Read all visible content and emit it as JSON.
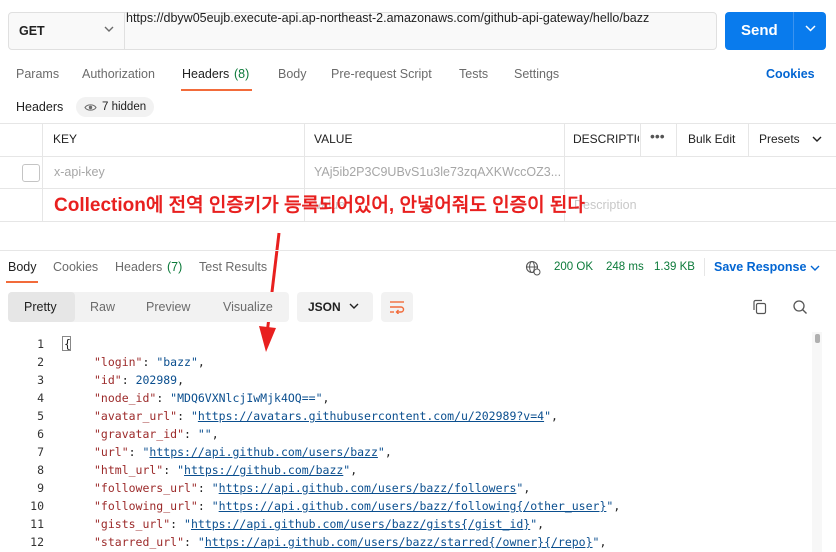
{
  "request": {
    "method": "GET",
    "url": "https://dbyw05eujb.execute-api.ap-northeast-2.amazonaws.com/github-api-gateway/hello/bazz",
    "send_label": "Send"
  },
  "request_tabs": [
    "Params",
    "Authorization",
    "Headers",
    "(8)",
    "Body",
    "Pre-request Script",
    "Tests",
    "Settings"
  ],
  "cookies_label": "Cookies",
  "headers_section": {
    "label": "Headers",
    "hidden": "7 hidden"
  },
  "table": {
    "columns": [
      "KEY",
      "VALUE",
      "DESCRIPTIO"
    ],
    "bulk_edit": "Bulk Edit",
    "presets": "Presets",
    "row": {
      "key": "x-api-key",
      "value": "YAj5ib2P3C9UBvS1u3le73zqAXKWccOZ3...",
      "value2": "Value",
      "desc2": "Description"
    }
  },
  "annotation": "Collection에 전역 인증키가 등록되어있어, 안넣어줘도 인증이 된다",
  "response": {
    "tabs": [
      "Body",
      "Cookies",
      "Headers",
      "(7)",
      "Test Results"
    ],
    "status": "200 OK",
    "time": "248 ms",
    "size": "1.39 KB",
    "save_label": "Save Response",
    "views": [
      "Pretty",
      "Raw",
      "Preview",
      "Visualize"
    ],
    "format": "JSON"
  },
  "code_lines": [
    {
      "n": "1",
      "key": "",
      "val": "{"
    },
    {
      "n": "2",
      "key": "\"login\"",
      "val": "\"bazz\"",
      "type": "s"
    },
    {
      "n": "3",
      "key": "\"id\"",
      "val": "202989",
      "type": "n"
    },
    {
      "n": "4",
      "key": "\"node_id\"",
      "val": "\"MDQ6VXNlcjIwMjk4OQ==\"",
      "type": "s"
    },
    {
      "n": "5",
      "key": "\"avatar_url\"",
      "val": "https://avatars.githubusercontent.com/u/202989?v=4",
      "type": "u"
    },
    {
      "n": "6",
      "key": "\"gravatar_id\"",
      "val": "\"\"",
      "type": "s"
    },
    {
      "n": "7",
      "key": "\"url\"",
      "val": "https://api.github.com/users/bazz",
      "type": "u"
    },
    {
      "n": "8",
      "key": "\"html_url\"",
      "val": "https://github.com/bazz",
      "type": "u"
    },
    {
      "n": "9",
      "key": "\"followers_url\"",
      "val": "https://api.github.com/users/bazz/followers",
      "type": "u"
    },
    {
      "n": "10",
      "key": "\"following_url\"",
      "val": "https://api.github.com/users/bazz/following{/other_user}",
      "type": "u"
    },
    {
      "n": "11",
      "key": "\"gists_url\"",
      "val": "https://api.github.com/users/bazz/gists{/gist_id}",
      "type": "u"
    },
    {
      "n": "12",
      "key": "\"starred_url\"",
      "val": "https://api.github.com/users/bazz/starred{/owner}{/repo}",
      "type": "u"
    }
  ],
  "colors": {
    "accent": "#097bed",
    "tab_indicator": "#f26b3a",
    "annotation": "#e8201f",
    "status_ok": "#0c7a3a"
  }
}
